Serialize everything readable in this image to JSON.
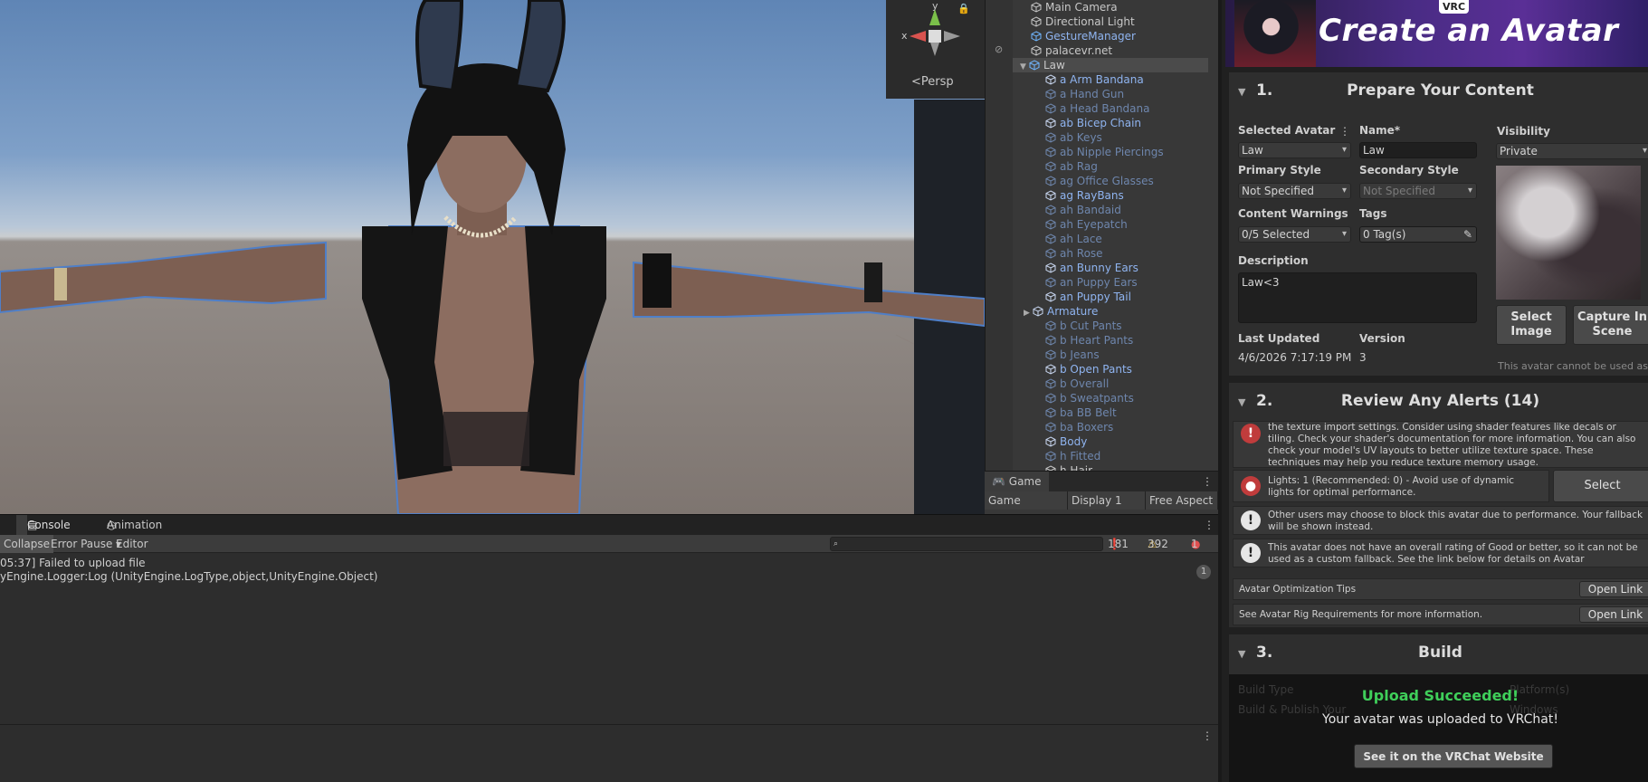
{
  "scene": {
    "gizmo": {
      "y_label": "y",
      "x_label": "x",
      "persp_label": "<Persp"
    }
  },
  "hierarchy": {
    "items": [
      {
        "label": "Main Camera",
        "style": "normal",
        "depth": 0
      },
      {
        "label": "Directional Light",
        "style": "normal",
        "depth": 0
      },
      {
        "label": "GestureManager",
        "style": "prefab",
        "depth": 0
      },
      {
        "label": "palacevr.net",
        "style": "normal",
        "depth": 0
      },
      {
        "label": "Law",
        "style": "selected",
        "depth": 0
      },
      {
        "label": "a Arm Bandana",
        "style": "prefab",
        "depth": 1
      },
      {
        "label": "a Hand Gun",
        "style": "dim",
        "depth": 1
      },
      {
        "label": "a Head Bandana",
        "style": "dim",
        "depth": 1
      },
      {
        "label": "ab Bicep Chain",
        "style": "prefab",
        "depth": 1
      },
      {
        "label": "ab Keys",
        "style": "dim",
        "depth": 1
      },
      {
        "label": "ab Nipple Piercings",
        "style": "dim",
        "depth": 1
      },
      {
        "label": "ab Rag",
        "style": "dim",
        "depth": 1
      },
      {
        "label": "ag Office Glasses",
        "style": "dim",
        "depth": 1
      },
      {
        "label": "ag RayBans",
        "style": "prefab",
        "depth": 1
      },
      {
        "label": "ah Bandaid",
        "style": "dim",
        "depth": 1
      },
      {
        "label": "ah Eyepatch",
        "style": "dim",
        "depth": 1
      },
      {
        "label": "ah Lace",
        "style": "dim",
        "depth": 1
      },
      {
        "label": "ah Rose",
        "style": "dim",
        "depth": 1
      },
      {
        "label": "an Bunny Ears",
        "style": "prefab",
        "depth": 1
      },
      {
        "label": "an Puppy Ears",
        "style": "dim",
        "depth": 1
      },
      {
        "label": "an Puppy Tail",
        "style": "prefab",
        "depth": 1
      },
      {
        "label": "Armature",
        "style": "prefab",
        "depth": 1
      },
      {
        "label": "b Cut Pants",
        "style": "dim",
        "depth": 1
      },
      {
        "label": "b Heart Pants",
        "style": "dim",
        "depth": 1
      },
      {
        "label": "b Jeans",
        "style": "dim",
        "depth": 1
      },
      {
        "label": "b Open Pants",
        "style": "prefab",
        "depth": 1
      },
      {
        "label": "b Overall",
        "style": "dim",
        "depth": 1
      },
      {
        "label": "b Sweatpants",
        "style": "dim",
        "depth": 1
      },
      {
        "label": "ba BB Belt",
        "style": "dim",
        "depth": 1
      },
      {
        "label": "ba Boxers",
        "style": "dim",
        "depth": 1
      },
      {
        "label": "Body",
        "style": "prefab",
        "depth": 1
      },
      {
        "label": "h Fitted",
        "style": "dim",
        "depth": 1
      },
      {
        "label": "h Hair",
        "style": "normal",
        "depth": 1
      }
    ]
  },
  "game": {
    "tab": "Game",
    "mode": "Game",
    "display": "Display 1",
    "aspect": "Free Aspect"
  },
  "console": {
    "tabs": {
      "console": "Console",
      "animation": "Animation"
    },
    "toolbar": {
      "collapse": "Collapse",
      "error_pause": "Error Pause",
      "editor": "Editor"
    },
    "counts": {
      "info": "181",
      "warn": "392",
      "error": "1"
    },
    "log_line1": "05:37] Failed to upload file",
    "log_line2": "yEngine.Logger:Log (UnityEngine.LogType,object,UnityEngine.Object)",
    "log_count": "1"
  },
  "sdk": {
    "banner": {
      "title": "Create an Avatar",
      "badge": "VRC"
    },
    "s1": {
      "num": "1.",
      "title": "Prepare Your Content",
      "selected_avatar_label": "Selected Avatar",
      "selected_avatar": "Law",
      "name_label": "Name*",
      "name": "Law",
      "visibility_label": "Visibility",
      "visibility": "Private",
      "primary_label": "Primary Style",
      "primary": "Not Specified",
      "secondary_label": "Secondary Style",
      "secondary": "Not Specified",
      "warnings_label": "Content Warnings",
      "warnings": "0/5 Selected",
      "tags_label": "Tags",
      "tags": "0 Tag(s)",
      "desc_label": "Description",
      "desc": "Law<3",
      "updated_label": "Last Updated",
      "updated": "4/6/2026 7:17:19 PM",
      "version_label": "Version",
      "version": "3",
      "select_image": "Select Image",
      "capture": "Capture In Scene",
      "note": "This avatar cannot be used as a"
    },
    "s2": {
      "num": "2.",
      "title": "Review Any Alerts (14)",
      "a1": "the texture import settings. Consider using shader features like decals or tiling. Check your shader's documentation for more information. You can also check your model's UV layouts to better utilize texture space. These techniques may help you reduce texture memory usage.",
      "a2": "Lights: 1 (Recommended: 0) - Avoid use of dynamic lights for optimal performance.",
      "a2_button": "Select",
      "a3": "Other users may choose to block this avatar due to performance. Your fallback will be shown instead.",
      "a4": "This avatar does not have an overall rating of Good or better, so it can not be used as a custom fallback. See the link below for details on Avatar Optimization.",
      "tip1": "Avatar Optimization Tips",
      "tip2": "See Avatar Rig Requirements for more information.",
      "open_link": "Open Link"
    },
    "s3": {
      "num": "3.",
      "title": "Build",
      "ghost1": "Build Type",
      "ghost2": "Platform(s)",
      "ghost3": "Build & Publish Your",
      "ghost4": "Windows",
      "success": "Upload Succeeded!",
      "message": "Your avatar was uploaded to VRChat!",
      "website_button": "See it on the VRChat Website"
    }
  }
}
